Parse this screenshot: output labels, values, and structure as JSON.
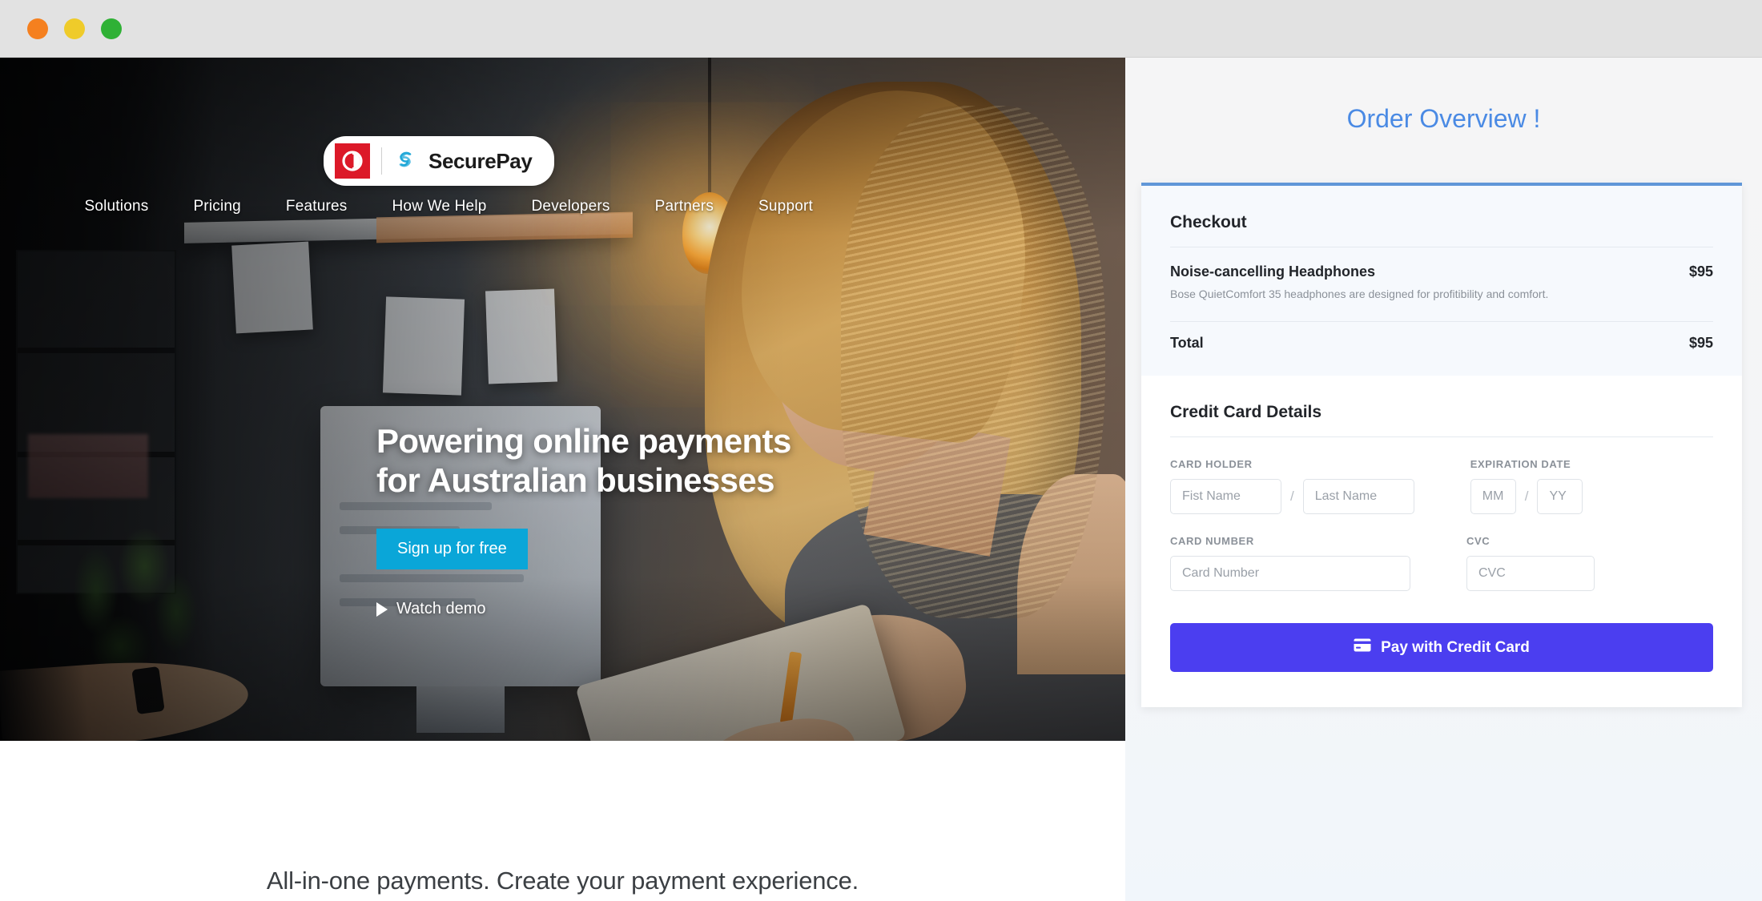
{
  "window": {
    "buttons": [
      {
        "name": "close",
        "color": "#f5801f"
      },
      {
        "name": "minimize",
        "color": "#efcb2a"
      },
      {
        "name": "maximize",
        "color": "#2fb135"
      }
    ]
  },
  "site": {
    "logo": {
      "brand_mark": "australia-post-p-mark",
      "spiral_mark": "securepay-spiral",
      "wordmark": "SecurePay",
      "mark_color": "#dc1928",
      "spiral_color": "#22a8d8"
    },
    "nav": [
      {
        "label": "Solutions"
      },
      {
        "label": "Pricing"
      },
      {
        "label": "Features"
      },
      {
        "label": "How We Help"
      },
      {
        "label": "Developers"
      },
      {
        "label": "Partners"
      },
      {
        "label": "Support"
      }
    ],
    "hero": {
      "title": "Powering online payments\nfor Australian businesses",
      "cta_label": "Sign up for free",
      "cta_color": "#0aa6d8",
      "secondary_label": "Watch demo"
    },
    "tagline": "All-in-one payments. Create your payment experience."
  },
  "checkout": {
    "panel_title": "Order Overview !",
    "panel_title_color": "#4a8ae4",
    "card_accent_color": "#6096d8",
    "summary": {
      "heading": "Checkout",
      "items": [
        {
          "name": "Noise-cancelling Headphones",
          "price": "$95",
          "description": "Bose QuietComfort 35 headphones are designed for profitibility and comfort."
        }
      ],
      "total_label": "Total",
      "total_value": "$95"
    },
    "form": {
      "heading": "Credit Card Details",
      "card_holder_label": "CARD HOLDER",
      "first_name_placeholder": "Fist Name",
      "last_name_placeholder": "Last Name",
      "name_separator": "/",
      "expiration_label": "EXPIRATION DATE",
      "month_placeholder": "MM",
      "year_placeholder": "YY",
      "date_separator": "/",
      "card_number_label": "CARD NUMBER",
      "card_number_placeholder": "Card Number",
      "cvc_label": "CVC",
      "cvc_placeholder": "CVC",
      "first_name_value": "",
      "last_name_value": "",
      "month_value": "",
      "year_value": "",
      "card_number_value": "",
      "cvc_value": "",
      "pay_button_label": "Pay with Credit Card",
      "pay_button_color": "#4b3ef0"
    }
  }
}
